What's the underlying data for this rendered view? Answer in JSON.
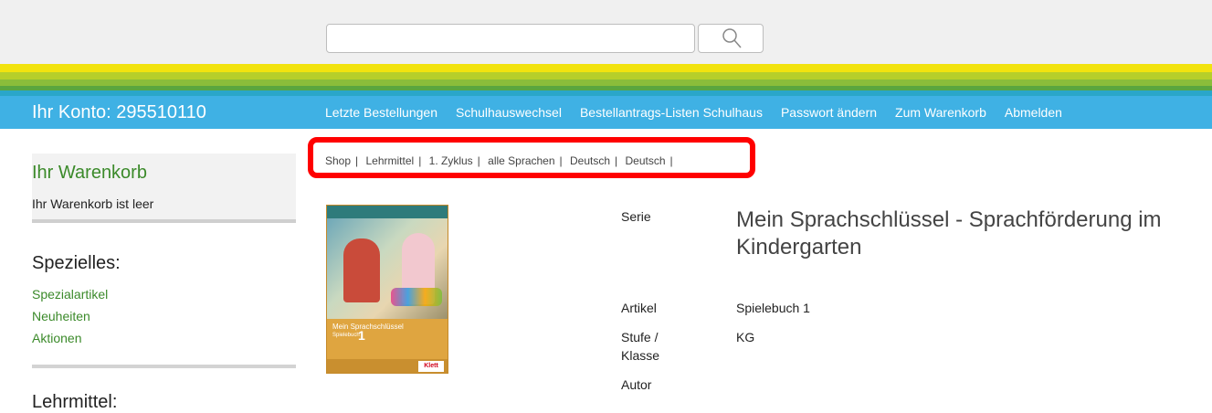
{
  "search": {
    "value": "",
    "placeholder": ""
  },
  "account": {
    "label": "Ihr Konto: 295510110"
  },
  "nav": [
    "Letzte Bestellungen",
    "Schulhauswechsel",
    "Bestellantrags-Listen Schulhaus",
    "Passwort ändern",
    "Zum Warenkorb",
    "Abmelden"
  ],
  "sidebar": {
    "cart_title": "Ihr Warenkorb",
    "cart_empty": "Ihr Warenkorb ist leer",
    "special_title": "Spezielles:",
    "special_links": [
      "Spezialartikel",
      "Neuheiten",
      "Aktionen"
    ],
    "teaching_title": "Lehrmittel:"
  },
  "breadcrumb": [
    "Shop",
    "Lehrmittel",
    "1. Zyklus",
    "alle Sprachen",
    "Deutsch",
    "Deutsch"
  ],
  "product": {
    "cover": {
      "title": "Mein Sprachschlüssel",
      "subtitle": "Spielebuch",
      "number": "1",
      "logo": "Klett"
    },
    "series_label": "Serie",
    "series_value": "Mein Sprachschlüssel - Sprachförderung im Kindergarten",
    "article_label": "Artikel",
    "article_value": "Spielebuch 1",
    "level_label_1": "Stufe /",
    "level_label_2": "Klasse",
    "level_value": "KG",
    "author_label": "Autor"
  },
  "colors": {
    "nav_bg": "#3fb1e4",
    "link_green": "#3b8a2a",
    "highlight": "#ff0000"
  }
}
